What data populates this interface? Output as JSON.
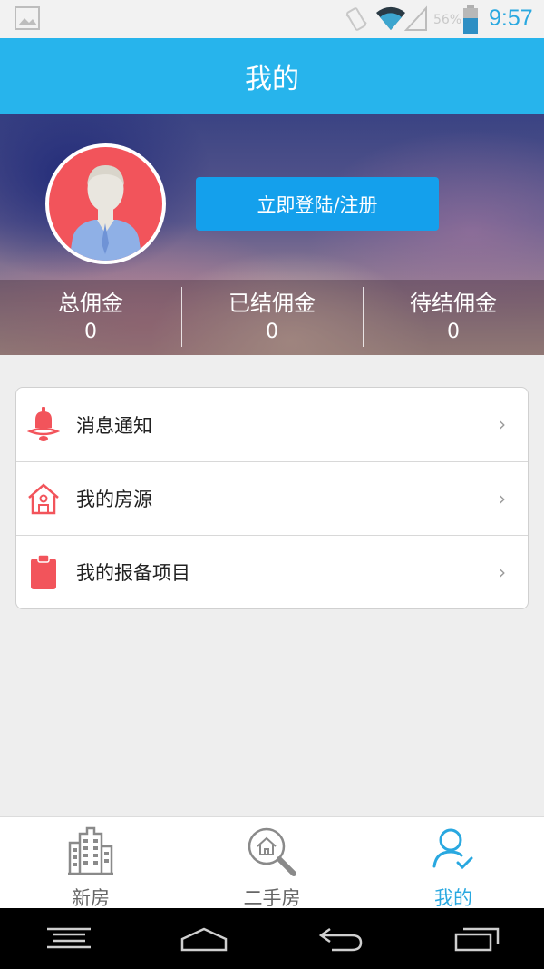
{
  "status_bar": {
    "time": "9:57",
    "battery_percent": "56%",
    "icons": [
      "image-icon",
      "vibrate-icon",
      "wifi-icon",
      "signal-icon",
      "battery-icon"
    ]
  },
  "header": {
    "title": "我的"
  },
  "profile": {
    "login_label": "立即登陆/注册",
    "stats": [
      {
        "label": "总佣金",
        "value": "0"
      },
      {
        "label": "已结佣金",
        "value": "0"
      },
      {
        "label": "待结佣金",
        "value": "0"
      }
    ]
  },
  "menu": {
    "items": [
      {
        "label": "消息通知",
        "icon": "bell-icon",
        "chevron": "›"
      },
      {
        "label": "我的房源",
        "icon": "house-icon",
        "chevron": "›"
      },
      {
        "label": "我的报备项目",
        "icon": "clipboard-icon",
        "chevron": "›"
      }
    ]
  },
  "tabs": [
    {
      "label": "新房",
      "icon": "building-icon",
      "active": false
    },
    {
      "label": "二手房",
      "icon": "house-search-icon",
      "active": false
    },
    {
      "label": "我的",
      "icon": "user-check-icon",
      "active": true
    }
  ],
  "colors": {
    "accent": "#27b4ec",
    "login_button": "#14a0ec",
    "menu_icon": "#f2545b",
    "tab_active": "#29a8e0"
  }
}
